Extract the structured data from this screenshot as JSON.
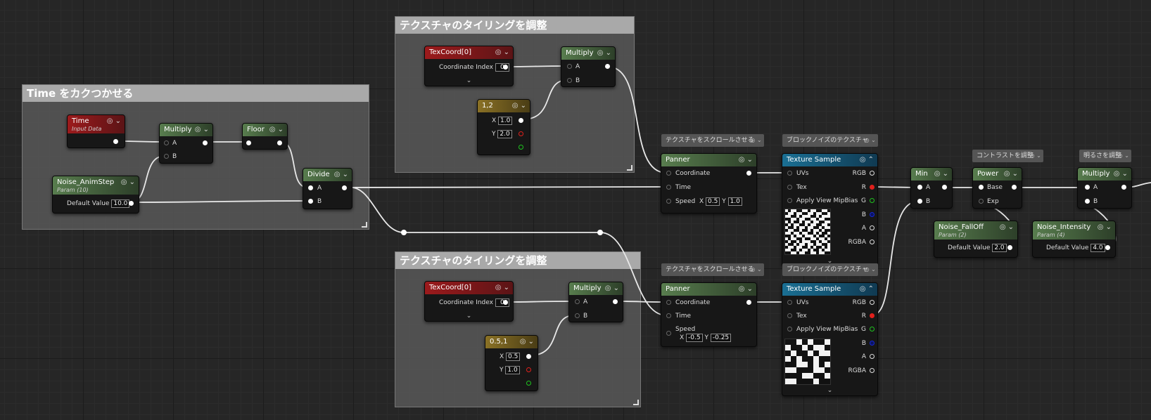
{
  "comments": {
    "time_step": "Time をカクつかせる",
    "tiling_top": "テクスチャのタイリングを調整",
    "tiling_bottom": "テクスチャのタイリングを調整"
  },
  "labels": {
    "scroll_top": "テクスチャをスクロールさせる",
    "noise_top": "ブロックノイズのテクスチャ",
    "scroll_bottom": "テクスチャをスクロールさせる",
    "noise_bottom": "ブロックノイズのテクスチャ",
    "contrast": "コントラストを調整",
    "brightness": "明るさを調整"
  },
  "pins": {
    "a": "A",
    "b": "B",
    "x": "X",
    "y": "Y",
    "coordinate": "Coordinate",
    "time": "Time",
    "speed": "Speed",
    "uvs": "UVs",
    "tex": "Tex",
    "apply_mip": "Apply View MipBias",
    "rgb": "RGB",
    "r": "R",
    "g": "G",
    "bch": "B",
    "ach": "A",
    "rgba": "RGBA",
    "base": "Base",
    "exp": "Exp",
    "coord_index": "Coordinate Index",
    "default_value": "Default Value"
  },
  "nodes": {
    "time": {
      "title": "Time",
      "subtitle": "Input Data"
    },
    "multiply_time": {
      "title": "Multiply"
    },
    "floor": {
      "title": "Floor"
    },
    "noise_animstep": {
      "title": "Noise_AnimStep",
      "subtitle": "Param (10)",
      "default_value": "10.0"
    },
    "divide": {
      "title": "Divide"
    },
    "texcoord_top": {
      "title": "TexCoord[0]",
      "index": "0"
    },
    "multiply_top": {
      "title": "Multiply"
    },
    "const_top": {
      "title": "1,2",
      "x": "1.0",
      "y": "2.0"
    },
    "panner_top": {
      "title": "Panner",
      "speed_x": "0.5",
      "speed_y": "1.0"
    },
    "texsample_top": {
      "title": "Texture Sample"
    },
    "texcoord_bottom": {
      "title": "TexCoord[0]",
      "index": "0"
    },
    "multiply_bottom": {
      "title": "Multiply"
    },
    "const_bottom": {
      "title": "0.5,1",
      "x": "0.5",
      "y": "1.0"
    },
    "panner_bottom": {
      "title": "Panner",
      "speed_x": "-0.5",
      "speed_y": "-0.25"
    },
    "texsample_bottom": {
      "title": "Texture Sample"
    },
    "min": {
      "title": "Min"
    },
    "power": {
      "title": "Power"
    },
    "noise_falloff": {
      "title": "Noise_FallOff",
      "subtitle": "Param (2)",
      "default_value": "2.0"
    },
    "multiply_final": {
      "title": "Multiply"
    },
    "noise_intensity": {
      "title": "Noise_Intensity",
      "subtitle": "Param (4)",
      "default_value": "4.0"
    }
  },
  "icons": {
    "node_controls": "◎ ⌄",
    "collapse_controls": "◎ ⌃",
    "tip_controls": "◎ ⌄",
    "expand_arrow": "⌄"
  },
  "colors": {
    "param_header": "#587d4e",
    "input_header": "#9c1a1c",
    "constant_header": "#8a7125",
    "texture_header": "#1a6f93",
    "red_channel": "#e0201c",
    "green_channel": "#1fc41f",
    "blue_channel": "#1426d8"
  }
}
